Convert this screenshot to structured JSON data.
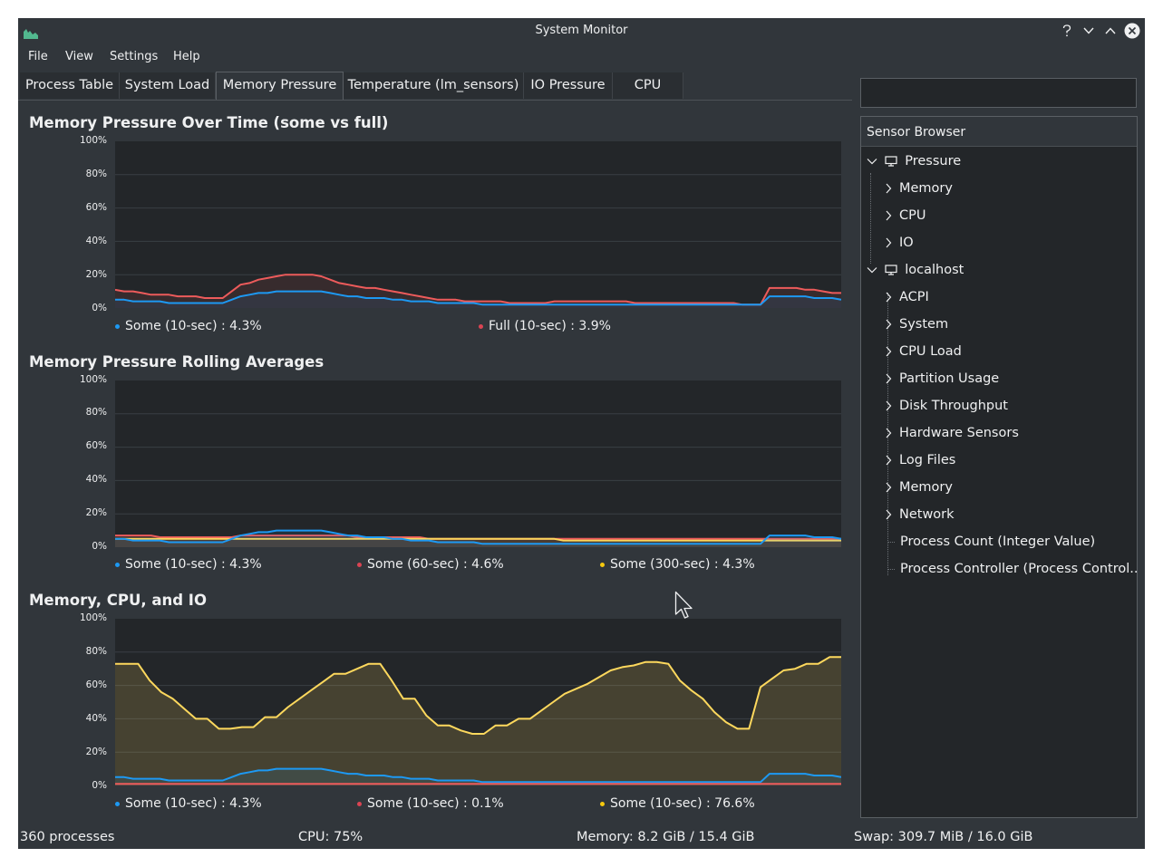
{
  "window": {
    "title": "System Monitor"
  },
  "menu": [
    "File",
    "View",
    "Settings",
    "Help"
  ],
  "tabs": [
    "Process Table",
    "System Load",
    "Memory Pressure",
    "Temperature (lm_sensors)",
    "IO Pressure",
    "CPU"
  ],
  "active_tab": "Memory Pressure",
  "colors": {
    "blue": "#1d99f3",
    "red": "#ed5b5b",
    "yellow": "#fdd85d",
    "bg": "#31363b",
    "plot_bg": "#232629"
  },
  "chart_data": [
    {
      "type": "area",
      "title": "Memory Pressure Over Time (some vs full)",
      "ylim": [
        0,
        100
      ],
      "y_ticks": [
        "100%",
        "80%",
        "60%",
        "40%",
        "20%",
        "0%"
      ],
      "legend": [
        {
          "label": "Some (10-sec) : 4.3%",
          "color": "#1d99f3"
        },
        {
          "label": "Full (10-sec) : 3.9%",
          "color": "#ed5b5b"
        }
      ],
      "series": [
        {
          "color": "#ed5b5b",
          "values": [
            11,
            10,
            10,
            9,
            8,
            8,
            8,
            7,
            7,
            7,
            6,
            6,
            6,
            10,
            14,
            15,
            17,
            18,
            19,
            20,
            20,
            20,
            20,
            19,
            17,
            15,
            14,
            13,
            12,
            12,
            11,
            10,
            9,
            8,
            7,
            6,
            5,
            5,
            5,
            4,
            4,
            4,
            4,
            4,
            3,
            3,
            3,
            3,
            3,
            4,
            4,
            4,
            4,
            4,
            4,
            4,
            4,
            4,
            3,
            3,
            3,
            3,
            3,
            3,
            3,
            3,
            3,
            3,
            3,
            3,
            2,
            2,
            2,
            12,
            12,
            12,
            12,
            11,
            11,
            10,
            9,
            9
          ]
        },
        {
          "color": "#1d99f3",
          "values": [
            5,
            5,
            4,
            4,
            4,
            4,
            3,
            3,
            3,
            3,
            3,
            3,
            3,
            5,
            7,
            8,
            9,
            9,
            10,
            10,
            10,
            10,
            10,
            10,
            9,
            8,
            7,
            7,
            6,
            6,
            6,
            5,
            5,
            4,
            4,
            4,
            3,
            3,
            3,
            3,
            3,
            2,
            2,
            2,
            2,
            2,
            2,
            2,
            2,
            2,
            2,
            2,
            2,
            2,
            2,
            2,
            2,
            2,
            2,
            2,
            2,
            2,
            2,
            2,
            2,
            2,
            2,
            2,
            2,
            2,
            2,
            2,
            2,
            7,
            7,
            7,
            7,
            7,
            6,
            6,
            6,
            5
          ]
        }
      ]
    },
    {
      "type": "area",
      "title": "Memory Pressure Rolling Averages",
      "ylim": [
        0,
        100
      ],
      "y_ticks": [
        "100%",
        "80%",
        "60%",
        "40%",
        "20%",
        "0%"
      ],
      "legend": [
        {
          "label": "Some (10-sec) : 4.3%",
          "color": "#1d99f3"
        },
        {
          "label": "Some (60-sec) : 4.6%",
          "color": "#ed5b5b"
        },
        {
          "label": "Some (300-sec) : 4.3%",
          "color": "#fdd85d"
        }
      ],
      "series": [
        {
          "color": "#ed5b5b",
          "values": [
            7,
            7,
            7,
            7,
            7,
            6,
            6,
            6,
            6,
            6,
            6,
            6,
            6,
            6,
            7,
            7,
            7,
            7,
            7,
            7,
            7,
            7,
            7,
            7,
            7,
            7,
            7,
            6,
            6,
            6,
            6,
            6,
            6,
            6,
            6,
            5,
            5,
            5,
            5,
            5,
            5,
            5,
            5,
            5,
            5,
            5,
            5,
            5,
            5,
            5,
            5,
            5,
            5,
            5,
            5,
            5,
            5,
            5,
            5,
            5,
            5,
            5,
            5,
            5,
            5,
            5,
            5,
            5,
            5,
            5,
            5,
            5,
            5,
            5,
            5,
            5,
            5,
            5,
            5,
            5,
            5,
            5
          ]
        },
        {
          "color": "#fdd85d",
          "values": [
            5,
            5,
            5,
            5,
            5,
            5,
            5,
            5,
            5,
            5,
            5,
            5,
            5,
            5,
            5,
            5,
            5,
            5,
            5,
            5,
            5,
            5,
            5,
            5,
            5,
            5,
            5,
            5,
            5,
            5,
            5,
            5,
            5,
            5,
            5,
            5,
            5,
            5,
            5,
            5,
            5,
            5,
            5,
            5,
            5,
            5,
            5,
            5,
            5,
            5,
            4,
            4,
            4,
            4,
            4,
            4,
            4,
            4,
            4,
            4,
            4,
            4,
            4,
            4,
            4,
            4,
            4,
            4,
            4,
            4,
            4,
            4,
            4,
            4,
            4,
            4,
            4,
            4,
            4,
            4,
            4,
            4
          ]
        },
        {
          "color": "#1d99f3",
          "values": [
            5,
            5,
            4,
            4,
            4,
            4,
            3,
            3,
            3,
            3,
            3,
            3,
            3,
            5,
            7,
            8,
            9,
            9,
            10,
            10,
            10,
            10,
            10,
            10,
            9,
            8,
            7,
            7,
            6,
            6,
            6,
            5,
            5,
            4,
            4,
            4,
            3,
            3,
            3,
            3,
            3,
            2,
            2,
            2,
            2,
            2,
            2,
            2,
            2,
            2,
            2,
            2,
            2,
            2,
            2,
            2,
            2,
            2,
            2,
            2,
            2,
            2,
            2,
            2,
            2,
            2,
            2,
            2,
            2,
            2,
            2,
            2,
            2,
            7,
            7,
            7,
            7,
            7,
            6,
            6,
            6,
            5
          ]
        }
      ]
    },
    {
      "type": "area",
      "title": "Memory, CPU, and IO",
      "ylim": [
        0,
        100
      ],
      "y_ticks": [
        "100%",
        "80%",
        "60%",
        "40%",
        "20%",
        "0%"
      ],
      "legend": [
        {
          "label": "Some (10-sec) : 4.3%",
          "color": "#1d99f3"
        },
        {
          "label": "Some (10-sec) : 0.1%",
          "color": "#ed5b5b"
        },
        {
          "label": "Some (10-sec) : 76.6%",
          "color": "#fdd85d"
        }
      ],
      "series": [
        {
          "color": "#fdd85d",
          "fill": true,
          "values": [
            73,
            73,
            73,
            63,
            56,
            52,
            46,
            40,
            40,
            34,
            34,
            35,
            35,
            41,
            41,
            47,
            52,
            57,
            62,
            67,
            67,
            70,
            73,
            73,
            63,
            52,
            52,
            42,
            36,
            36,
            33,
            31,
            31,
            36,
            36,
            40,
            40,
            45,
            50,
            55,
            58,
            61,
            65,
            69,
            71,
            72,
            74,
            74,
            73,
            63,
            57,
            52,
            44,
            38,
            34,
            34,
            59,
            64,
            69,
            70,
            73,
            73,
            77,
            77
          ]
        },
        {
          "color": "#1d99f3",
          "values": [
            5,
            5,
            4,
            4,
            4,
            4,
            3,
            3,
            3,
            3,
            3,
            3,
            3,
            5,
            7,
            8,
            9,
            9,
            10,
            10,
            10,
            10,
            10,
            10,
            9,
            8,
            7,
            7,
            6,
            6,
            6,
            5,
            5,
            4,
            4,
            4,
            3,
            3,
            3,
            3,
            3,
            2,
            2,
            2,
            2,
            2,
            2,
            2,
            2,
            2,
            2,
            2,
            2,
            2,
            2,
            2,
            2,
            2,
            2,
            2,
            2,
            2,
            2,
            2,
            2,
            2,
            2,
            2,
            2,
            2,
            2,
            2,
            2,
            7,
            7,
            7,
            7,
            7,
            6,
            6,
            6,
            5
          ]
        },
        {
          "color": "#ed5b5b",
          "values": [
            1,
            1,
            1,
            1,
            1,
            1,
            1,
            1,
            1,
            1,
            1,
            1,
            1,
            1,
            1,
            1,
            1,
            1,
            1,
            1,
            1,
            1,
            1,
            1,
            1,
            1,
            1,
            1,
            1,
            1,
            1,
            1,
            1,
            1,
            1,
            1,
            1,
            1,
            1,
            1,
            1,
            1,
            1,
            1,
            1,
            1,
            1,
            1,
            1,
            1,
            1,
            1,
            1,
            1,
            1,
            1,
            1,
            1,
            1,
            1
          ]
        }
      ]
    }
  ],
  "sensor_browser": {
    "title": "Sensor Browser",
    "groups": [
      {
        "label": "Pressure",
        "children": [
          "Memory",
          "CPU",
          "IO"
        ]
      },
      {
        "label": "localhost",
        "children": [
          "ACPI",
          "System",
          "CPU Load",
          "Partition Usage",
          "Disk Throughput",
          "Hardware Sensors",
          "Log Files",
          "Memory",
          "Network",
          "Process Count (Integer Value)",
          "Process Controller (Process Control..."
        ]
      }
    ]
  },
  "status": {
    "processes": "360 processes",
    "cpu": "CPU: 75%",
    "memory": "Memory: 8.2 GiB / 15.4 GiB",
    "swap": "Swap: 309.7 MiB / 16.0 GiB"
  }
}
